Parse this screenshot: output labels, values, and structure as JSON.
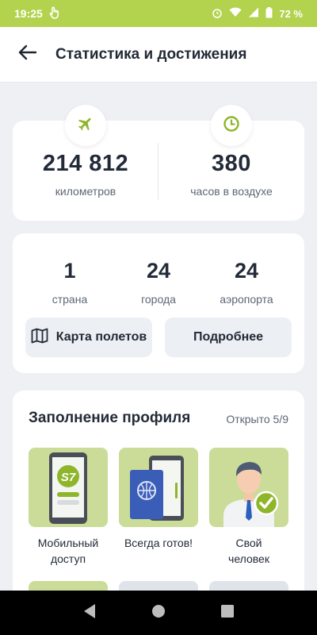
{
  "status_bar": {
    "time": "19:25",
    "battery": "72 %"
  },
  "header": {
    "title": "Статистика и достижения"
  },
  "summary": {
    "distance": {
      "value": "214 812",
      "label": "километров"
    },
    "hours": {
      "value": "380",
      "label": "часов в воздухе"
    }
  },
  "geography": {
    "stats": [
      {
        "value": "1",
        "label": "страна"
      },
      {
        "value": "24",
        "label": "города"
      },
      {
        "value": "24",
        "label": "аэропорта"
      }
    ],
    "map_button": "Карта полетов",
    "details_button": "Подробнее"
  },
  "profile": {
    "title": "Заполнение профиля",
    "progress": "Открыто 5/9",
    "achievements": [
      {
        "label_line1": "Мобильный",
        "label_line2": "доступ",
        "badge": "S7"
      },
      {
        "label_line1": "Всегда готов!",
        "label_line2": ""
      },
      {
        "label_line1": "Свой",
        "label_line2": "человек"
      }
    ]
  },
  "colors": {
    "accent": "#b3d24e",
    "tile": "#cadc97",
    "background": "#eef0f4"
  },
  "icons": [
    "hand-icon",
    "alarm-icon",
    "wifi-icon",
    "signal-icon",
    "battery-icon",
    "back-arrow-icon",
    "plane-icon",
    "clock-icon",
    "map-icon",
    "nav-back-icon",
    "nav-home-icon",
    "nav-recents-icon"
  ]
}
